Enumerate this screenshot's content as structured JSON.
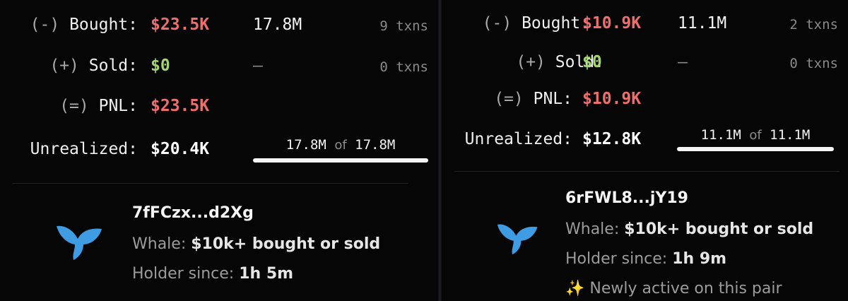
{
  "left": {
    "bought": {
      "op": "(-)",
      "label": "Bought:",
      "value": "$23.5K",
      "amount": "17.8M",
      "txns": "9 txns"
    },
    "sold": {
      "op": "(+)",
      "label": "Sold:",
      "value": "$0",
      "amount": "–",
      "txns": "0 txns"
    },
    "pnl": {
      "op": "(=)",
      "label": "PNL:",
      "value": "$23.5K"
    },
    "unrealized": {
      "label": "Unrealized:",
      "value": "$20.4K",
      "held": "17.8M",
      "of": "of",
      "total": "17.8M",
      "held_fraction": 1.0
    },
    "holder": {
      "address": "7fFCzx...d2Xg",
      "whale_label": "Whale:",
      "whale_value": "$10k+ bought or sold",
      "since_label": "Holder since:",
      "since_value": "1h 5m",
      "icon": "whale-tail-icon"
    }
  },
  "right": {
    "bought": {
      "op": "(-)",
      "label": "Bought:",
      "value": "$10.9K",
      "amount": "11.1M",
      "txns": "2 txns"
    },
    "sold": {
      "op": "(+)",
      "label": "Sold:",
      "value": "$0",
      "amount": "–",
      "txns": "0 txns"
    },
    "pnl": {
      "op": "(=)",
      "label": "PNL:",
      "value": "$10.9K"
    },
    "unrealized": {
      "label": "Unrealized:",
      "value": "$12.8K",
      "held": "11.1M",
      "of": "of",
      "total": "11.1M",
      "held_fraction": 1.0
    },
    "holder": {
      "address": "6rFWL8...jY19",
      "whale_label": "Whale:",
      "whale_value": "$10k+ bought or sold",
      "since_label": "Holder since:",
      "since_value": "1h 9m",
      "new_icon": "✨",
      "new_text": "Newly active on this pair",
      "icon": "whale-tail-icon"
    }
  },
  "colors": {
    "negative": "#ef6f6c",
    "positive": "#a4d66d",
    "background": "#060607",
    "muted": "#8a8a8a"
  }
}
